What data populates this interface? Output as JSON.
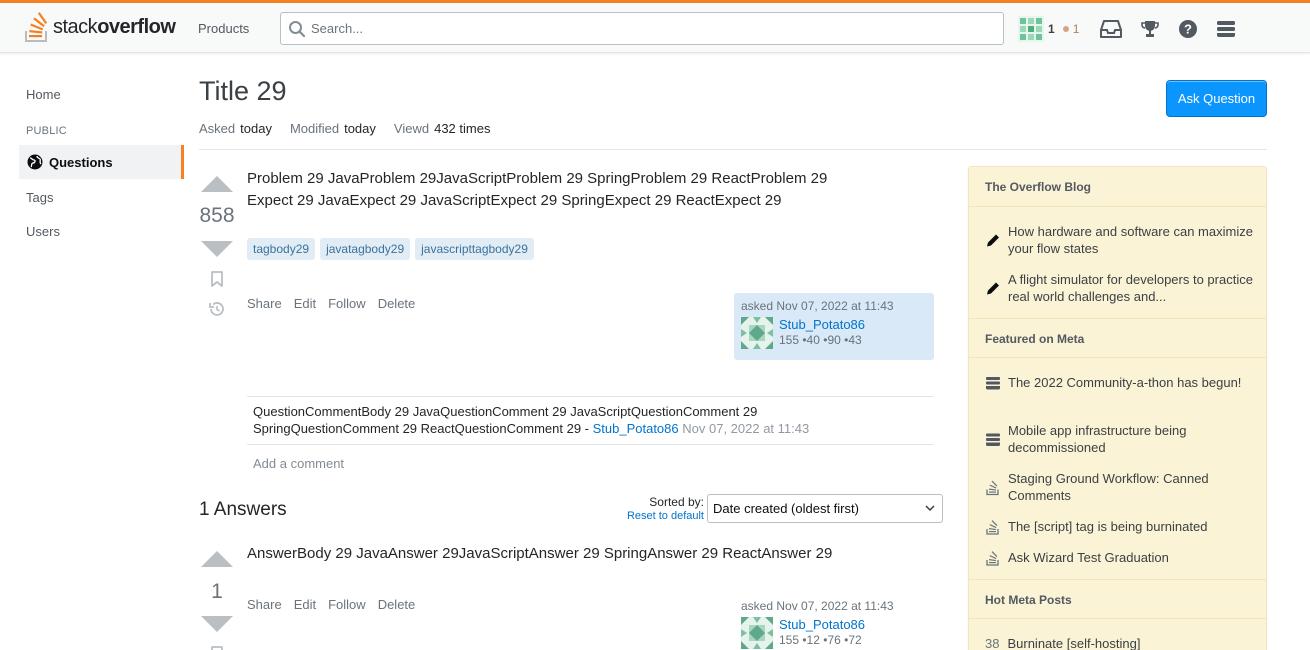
{
  "header": {
    "logo_text_regular": "stack",
    "logo_text_bold": "overflow",
    "products_label": "Products",
    "search_placeholder": "Search...",
    "reputation": "1",
    "bronze_badges": "1",
    "icons": [
      "inbox-icon",
      "achievements-icon",
      "help-icon",
      "site-switcher-icon"
    ]
  },
  "left_nav": {
    "home": "Home",
    "section_label": "PUBLIC",
    "questions": "Questions",
    "tags": "Tags",
    "users": "Users"
  },
  "question": {
    "title": "Title 29",
    "ask_button": "Ask Question",
    "asked_label": "Asked",
    "asked_value": "today",
    "modified_label": "Modified",
    "modified_value": "today",
    "viewed_label": "Viewd",
    "viewed_value": "432 times",
    "votes": "858",
    "body": "Problem 29 JavaProblem 29JavaScriptProblem 29 SpringProblem 29 ReactProblem 29 Expect 29 JavaExpect 29 JavaScriptExpect 29 SpringExpect 29 ReactExpect 29",
    "tags": [
      "tagbody29",
      "javatagbody29",
      "javascripttagbody29"
    ],
    "menu": {
      "share": "Share",
      "edit": "Edit",
      "follow": "Follow",
      "delete": "Delete"
    },
    "owner": {
      "asked": "asked Nov 07, 2022 at 11:43",
      "name": "Stub_Potato86",
      "stats": "155 •40 •90 •43"
    },
    "comment": {
      "body": "QuestionCommentBody 29 JavaQuestionComment 29 JavaScriptQuestionComment 29 SpringQuestionComment 29 ReactQuestionComment 29 - ",
      "user": "Stub_Potato86",
      "date": " Nov 07, 2022 at 11:43"
    },
    "add_comment": "Add a comment"
  },
  "answers": {
    "header": "1 Answers",
    "sorted_by": "Sorted by:",
    "reset": "Reset to default",
    "sort_value": "Date created (oldest first)",
    "items": [
      {
        "votes": "1",
        "body": "AnswerBody 29 JavaAnswer 29JavaScriptAnswer 29 SpringAnswer 29 ReactAnswer 29",
        "menu": {
          "share": "Share",
          "edit": "Edit",
          "follow": "Follow",
          "delete": "Delete"
        },
        "owner": {
          "asked": "asked Nov 07, 2022 at 11:43",
          "name": "Stub_Potato86",
          "stats": "155 •12 •76 •72"
        }
      }
    ]
  },
  "sidebar": {
    "blog_header": "The Overflow Blog",
    "blog_items": [
      "How hardware and software can maximize your flow states",
      "A flight simulator for developers to practice real world challenges and..."
    ],
    "meta_header": "Featured on Meta",
    "meta_items": [
      "The 2022 Community-a-thon has begun!",
      "Mobile app infrastructure being decommissioned",
      "Staging Ground Workflow: Canned Comments",
      "The [script] tag is being burninated",
      "Ask Wizard Test Graduation"
    ],
    "hot_header": "Hot Meta Posts",
    "hot_items": [
      {
        "count": "38",
        "title": "Burninate [self-hosting]"
      }
    ]
  },
  "colors": {
    "accent_orange": "#f48225",
    "primary_blue": "#0a95ff",
    "link_blue": "#0074cc",
    "tag_bg": "#e1ecf4",
    "sidebar_bg": "#fbf3d5"
  }
}
